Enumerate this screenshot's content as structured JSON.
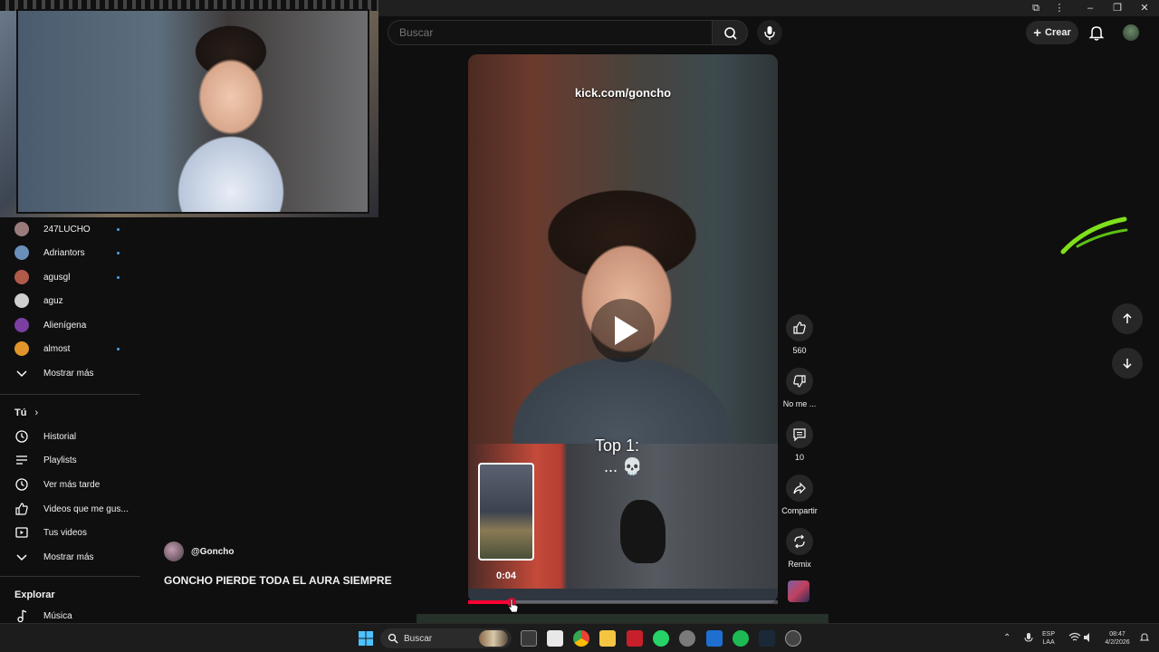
{
  "search": {
    "placeholder": "Buscar"
  },
  "header": {
    "create_label": "Crear"
  },
  "subscriptions": [
    {
      "name": "247LUCHO",
      "color": "#9a7b7b",
      "new": true
    },
    {
      "name": "Adriantors",
      "color": "#6a8fb8",
      "new": true
    },
    {
      "name": "agusgl",
      "color": "#b05a4a",
      "new": true
    },
    {
      "name": "aguz",
      "color": "#cfcfcf",
      "new": false
    },
    {
      "name": "Alienígena",
      "color": "#7a3fa0",
      "new": false
    },
    {
      "name": "almost",
      "color": "#e0952a",
      "new": true
    }
  ],
  "sidebar": {
    "show_more_1": "Mostrar más",
    "you_heading": "Tú",
    "you_items": [
      "Historial",
      "Playlists",
      "Ver más tarde",
      "Videos que me gus...",
      "Tus videos"
    ],
    "show_more_2": "Mostrar más",
    "explore_heading": "Explorar",
    "music": "Música"
  },
  "short": {
    "overlay_url": "kick.com/goncho",
    "caption_top": "Top 1:",
    "caption_emoji": "... 💀",
    "timecode": "0:04",
    "progress": 0.14
  },
  "actions": {
    "likes": "560",
    "dislike": "No me ...",
    "comments": "10",
    "share": "Compartir",
    "remix": "Remix"
  },
  "channel": {
    "handle": "@Goncho"
  },
  "video_title": "GONCHO PIERDE TODA EL AURA SIEMPRE",
  "taskbar": {
    "search": "Buscar",
    "lang": "ESP",
    "lang2": "LAA",
    "time": "08:47",
    "date": "4/2/2026"
  }
}
